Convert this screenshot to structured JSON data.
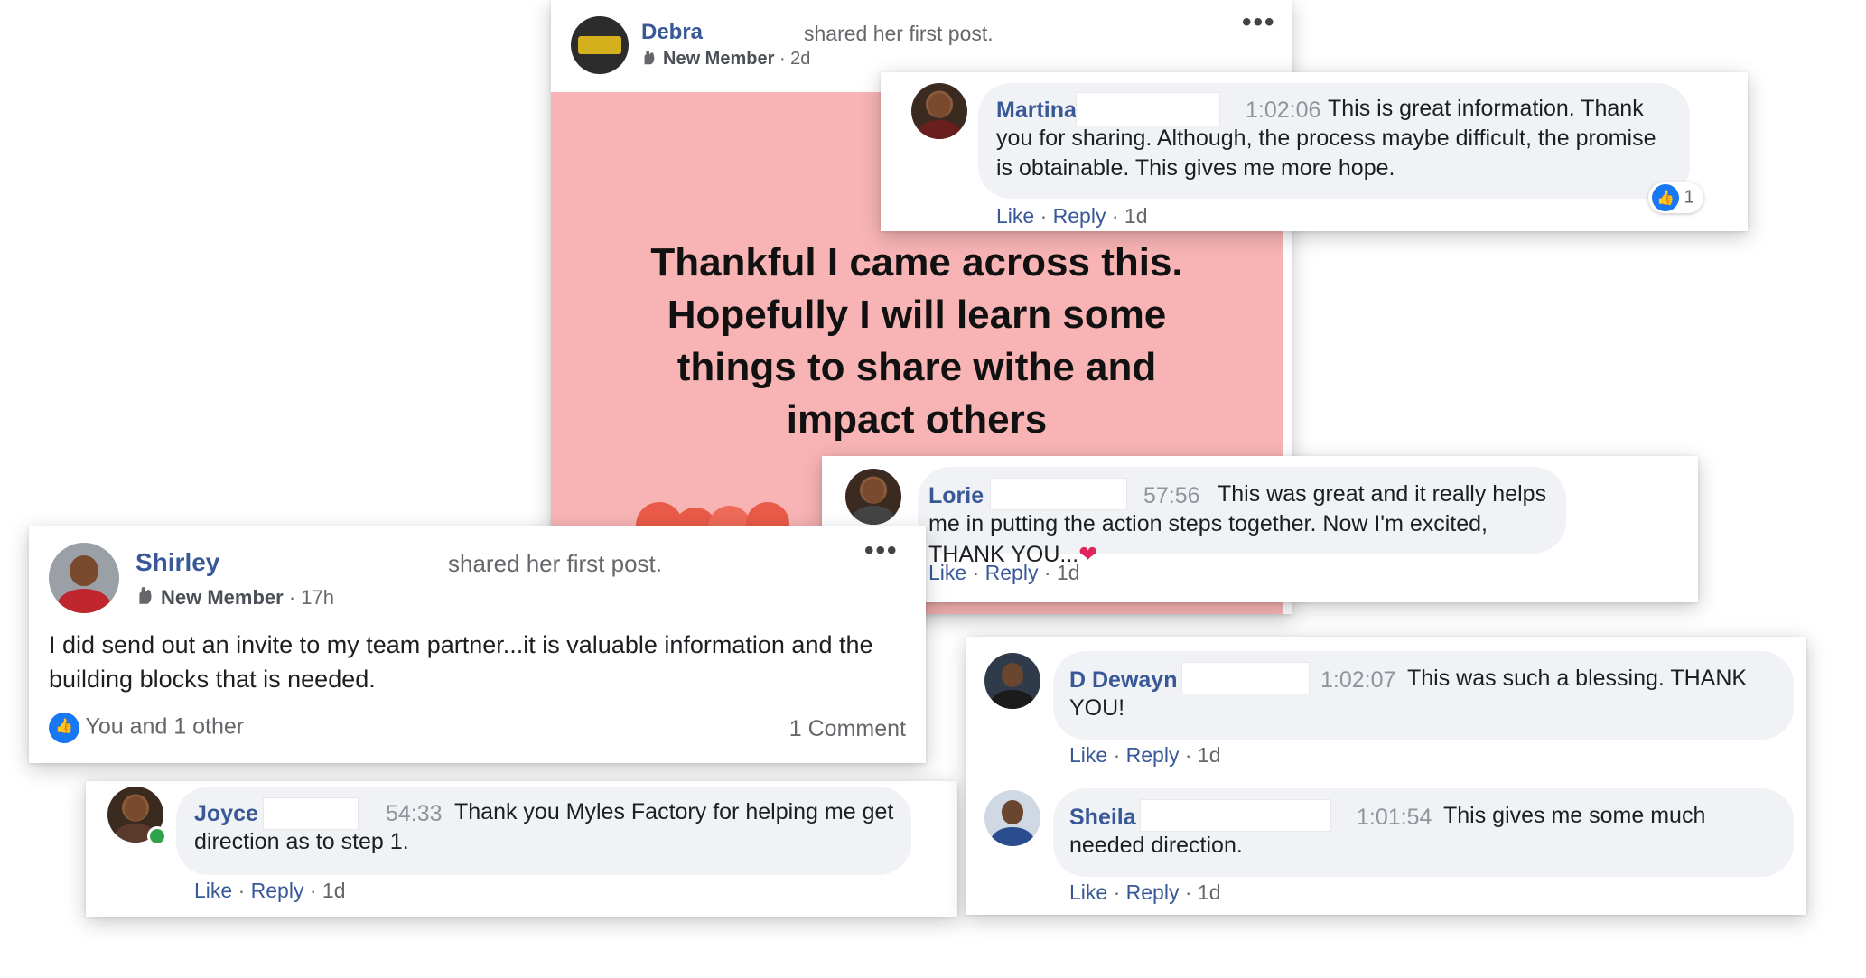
{
  "debra_post": {
    "author": "Debra",
    "shared_text": "shared her first post.",
    "badge": "New Member",
    "time": "· 2d",
    "banner_text": "Thankful I came across this. Hopefully I will learn some things to share withe and impact others",
    "banner_color": "#f8b4b4"
  },
  "martina_comment": {
    "author": "Martina",
    "timestamp": "1:02:06",
    "text": "This is great information. Thank you for sharing. Although, the process maybe difficult, the promise is obtainable. This gives me more hope.",
    "like_label": "Like",
    "reply_label": "Reply",
    "age": "1d",
    "reaction_count": "1"
  },
  "lorie_comment": {
    "author": "Lorie",
    "timestamp": "57:56",
    "text": "This was great and it really helps me in putting the action steps together. Now I'm excited, THANK YOU...",
    "like_label": "Like",
    "reply_label": "Reply",
    "age": "1d"
  },
  "shirley_post": {
    "author": "Shirley",
    "shared_text": "shared her first post.",
    "badge": "New Member",
    "time": "· 17h",
    "body": "I did send out an invite to my team partner...it is valuable information and the building blocks that is needed.",
    "reactions": "You and 1 other",
    "comments": "1 Comment"
  },
  "joyce_comment": {
    "author": "Joyce",
    "timestamp": "54:33",
    "text": "Thank you Myles Factory for helping me get direction as to step 1.",
    "like_label": "Like",
    "reply_label": "Reply",
    "age": "1d"
  },
  "dewayne_comment": {
    "author": "D Dewayn",
    "timestamp": "1:02:07",
    "text": "This was such a blessing. THANK YOU!",
    "like_label": "Like",
    "reply_label": "Reply",
    "age": "1d"
  },
  "sheila_comment": {
    "author": "Sheila",
    "timestamp": "1:01:54",
    "text": "This gives me some much needed direction.",
    "like_label": "Like",
    "reply_label": "Reply",
    "age": "1d"
  },
  "colors": {
    "link_blue": "#385898",
    "like_blue": "#1877f2",
    "bubble_gray": "#f0f2f5",
    "heart_red": "#e0245e"
  },
  "icons": [
    "hand-wave-icon",
    "more-options-icon",
    "like-reaction-icon",
    "heart-emoji-icon",
    "online-status-icon"
  ]
}
